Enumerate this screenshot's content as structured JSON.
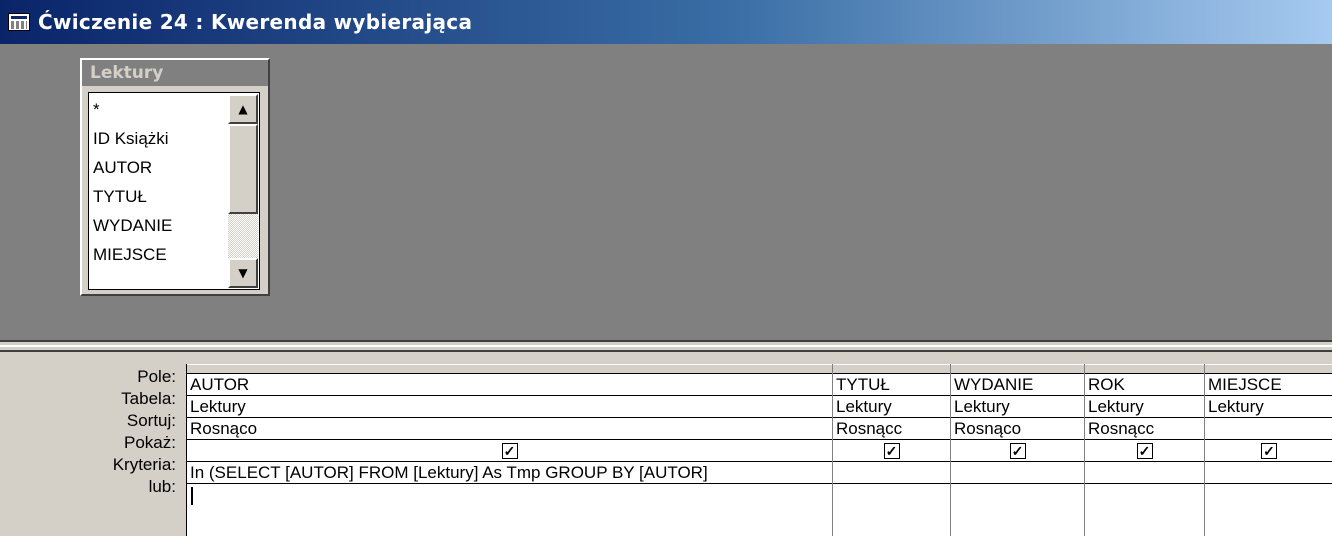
{
  "window": {
    "title": "Ćwiczenie 24 : Kwerenda wybierająca",
    "icon": "query-icon",
    "colors": {
      "titlebar_start": "#0a246a",
      "titlebar_end": "#a6caf0",
      "face": "#d4d0c8",
      "pane": "#808080"
    }
  },
  "field_list": {
    "title": "Lektury",
    "items": [
      "*",
      "ID Książki",
      "AUTOR",
      "TYTUŁ",
      "WYDANIE",
      "MIEJSCE"
    ],
    "scroll_up_icon": "▲",
    "scroll_down_icon": "▼"
  },
  "hscroll": {
    "left_icon": "◀"
  },
  "grid": {
    "row_labels": [
      "Pole:",
      "Tabela:",
      "Sortuj:",
      "Pokaż:",
      "Kryteria:",
      "lub:"
    ],
    "columns": [
      {
        "field": "AUTOR",
        "table": "Lektury",
        "sort": "Rosnąco",
        "show": true,
        "criteria": "In (SELECT [AUTOR] FROM [Lektury] As Tmp GROUP BY [AUTOR]",
        "or": ""
      },
      {
        "field": "TYTUŁ",
        "table": "Lektury",
        "sort": "Rosnącc",
        "show": true,
        "criteria": "",
        "or": ""
      },
      {
        "field": "WYDANIE",
        "table": "Lektury",
        "sort": "Rosnąco",
        "show": true,
        "criteria": "",
        "or": ""
      },
      {
        "field": "ROK",
        "table": "Lektury",
        "sort": "Rosnącc",
        "show": true,
        "criteria": "",
        "or": ""
      },
      {
        "field": "MIEJSCE",
        "table": "Lektury",
        "sort": "",
        "show": true,
        "criteria": "",
        "or": ""
      }
    ],
    "check_mark": "✓"
  }
}
